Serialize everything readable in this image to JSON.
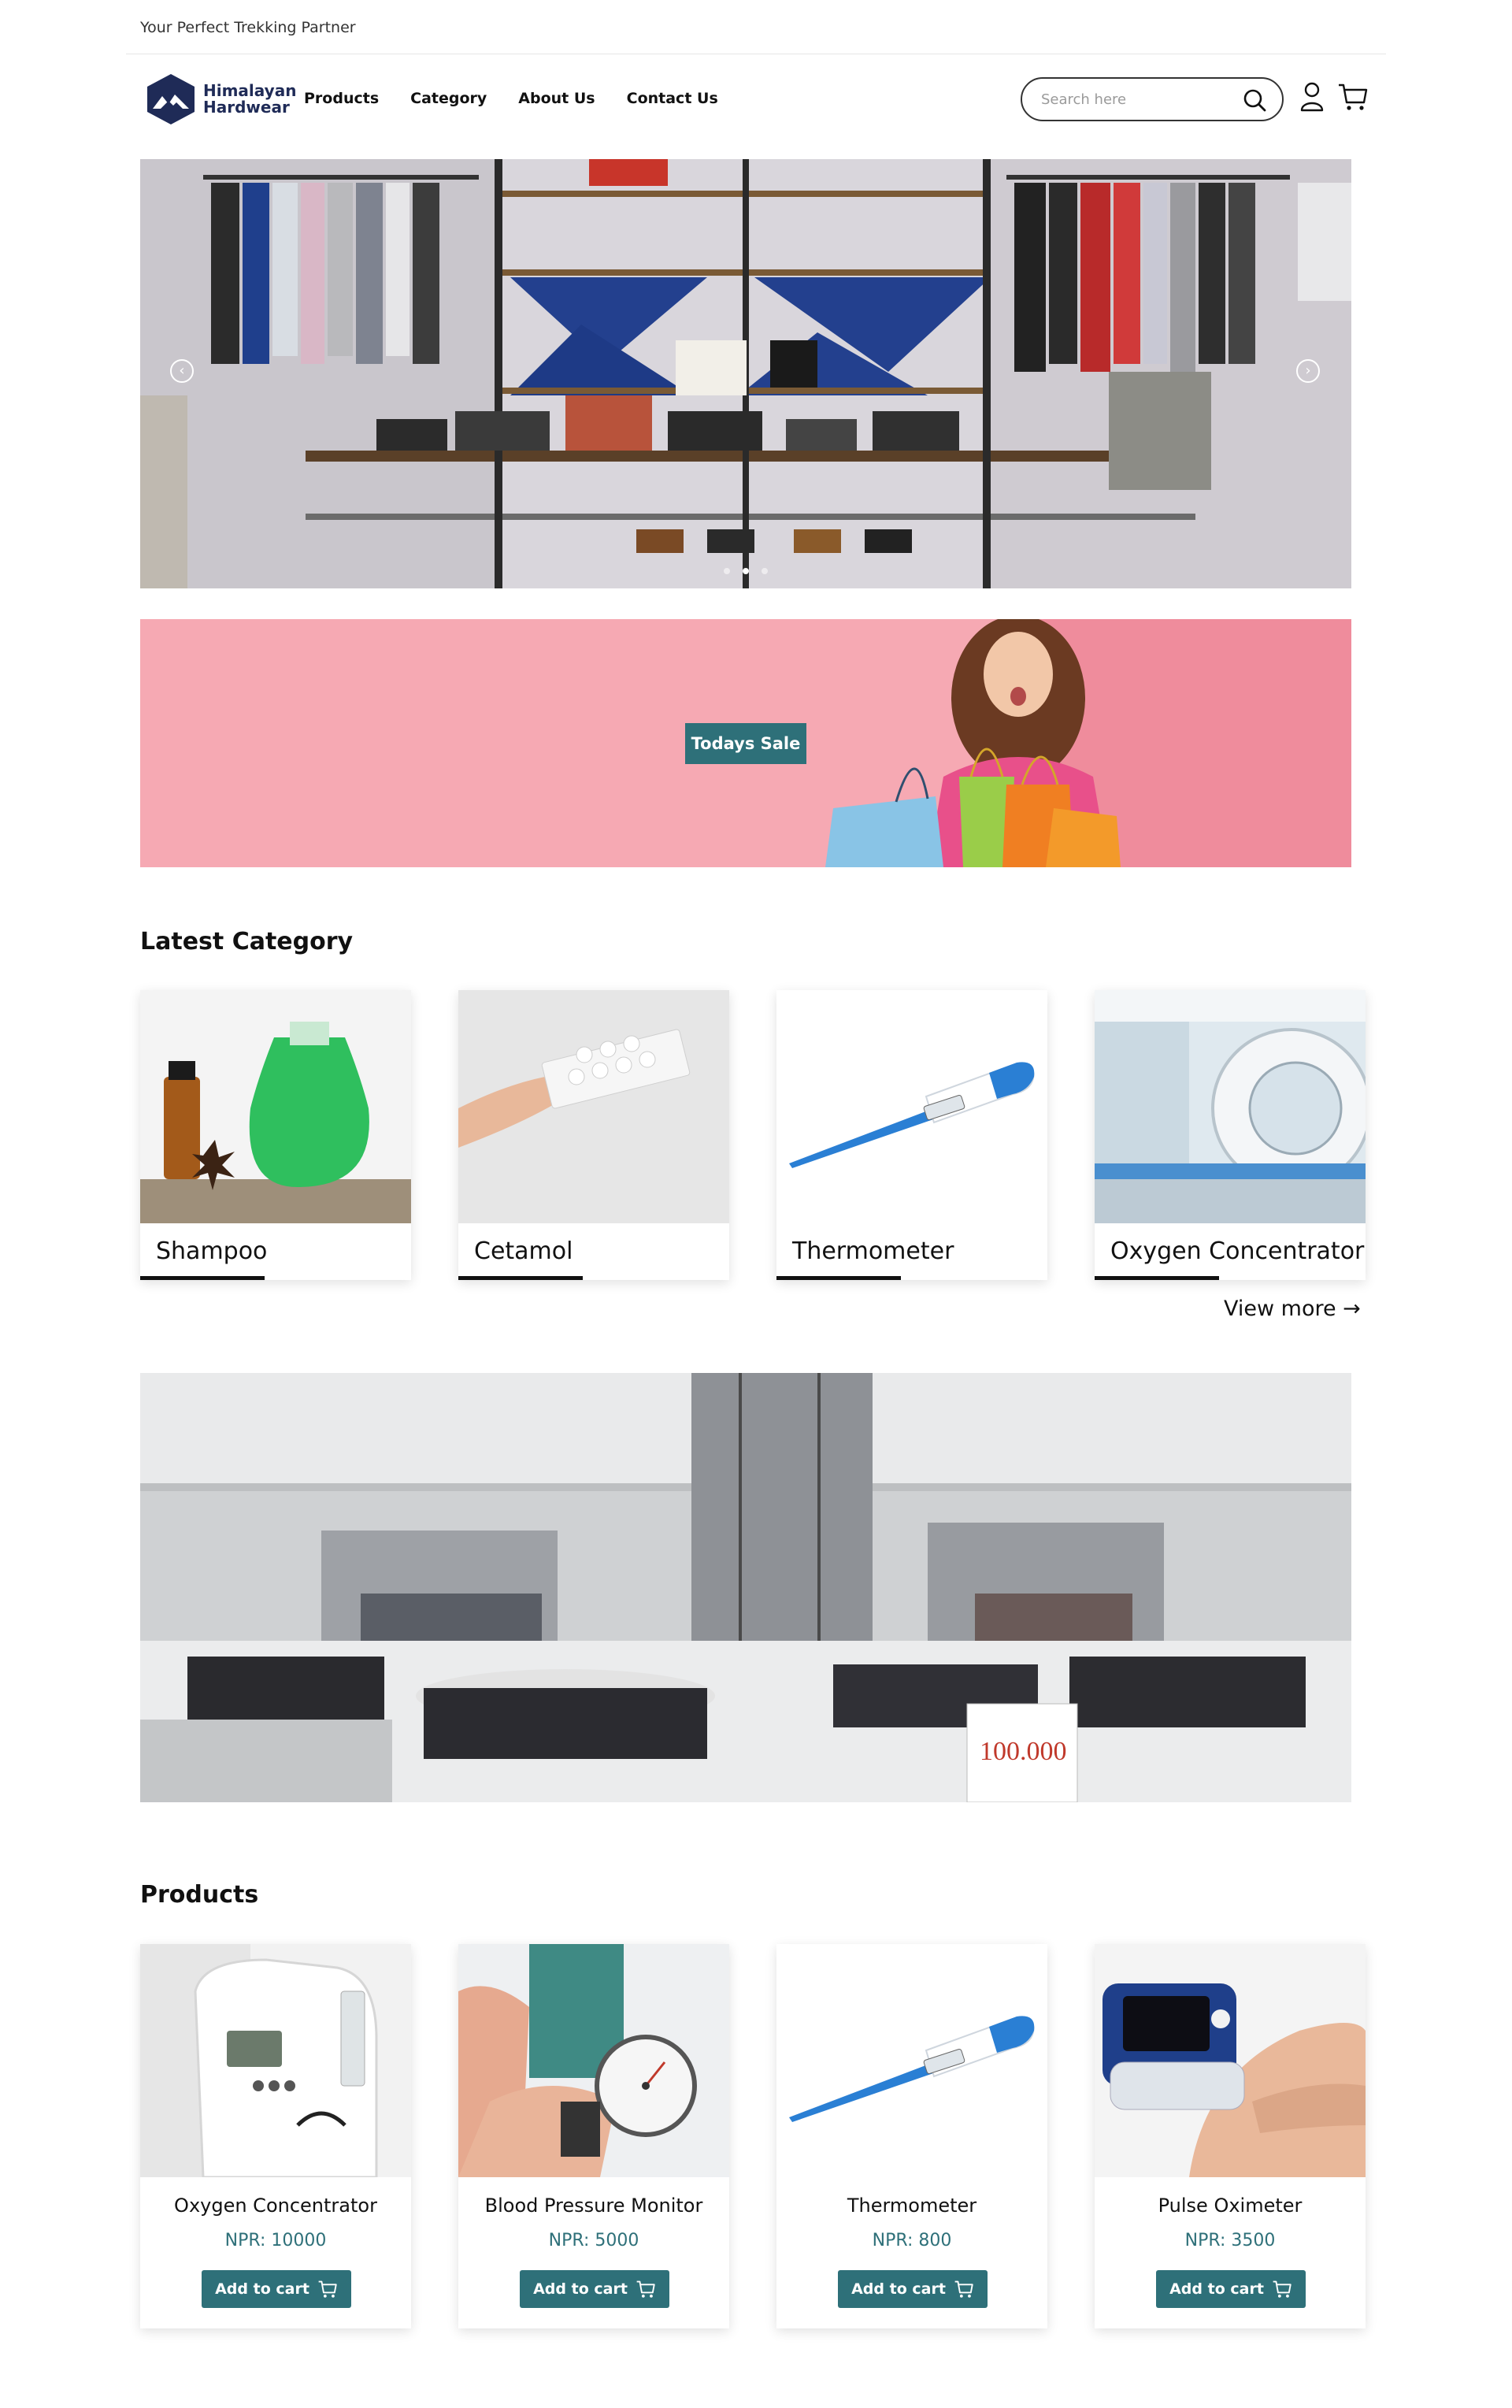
{
  "top_bar": {
    "tagline": "Your Perfect Trekking Partner"
  },
  "header": {
    "logo_line1": "Himalayan",
    "logo_line2": "Hardwear",
    "nav": [
      "Products",
      "Category",
      "About Us",
      "Contact Us"
    ],
    "search_placeholder": "Search here",
    "icons": [
      "search-icon",
      "user-icon",
      "cart-icon"
    ]
  },
  "hero": {
    "slide_count": 3,
    "active_slide": 2
  },
  "sale_banner": {
    "button_label": "Todays Sale"
  },
  "latest_category": {
    "title": "Latest Category",
    "items": [
      {
        "label": "Shampoo"
      },
      {
        "label": "Cetamol"
      },
      {
        "label": "Thermometer"
      },
      {
        "label": "Oxygen Concentrator"
      }
    ],
    "view_more": "View more →"
  },
  "store_banner": {
    "price_sign": "100.000"
  },
  "products": {
    "title": "Products",
    "items": [
      {
        "name": "Oxygen Concentrator",
        "price": "NPR: 10000",
        "cta": "Add to cart"
      },
      {
        "name": "Blood Pressure Monitor",
        "price": "NPR: 5000",
        "cta": "Add to cart"
      },
      {
        "name": "Thermometer",
        "price": "NPR: 800",
        "cta": "Add to cart"
      },
      {
        "name": "Pulse Oximeter",
        "price": "NPR: 3500",
        "cta": "Add to cart"
      }
    ]
  },
  "colors": {
    "accent": "#2e7079",
    "sale_background": "#f6a9b3",
    "logo": "#1f2b57"
  }
}
